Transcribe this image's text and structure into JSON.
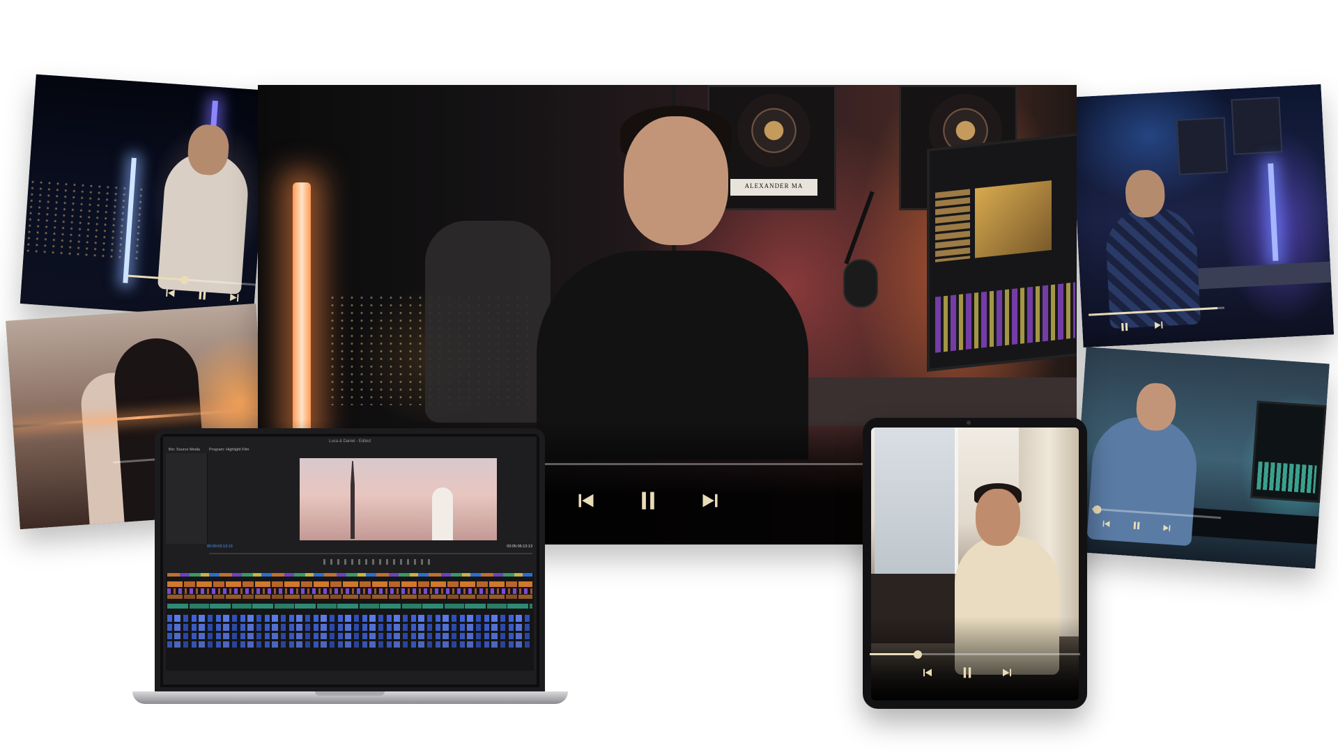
{
  "hero": {
    "award_plate": "ALEXANDER MA",
    "progress": 0.04
  },
  "card_top_left": {
    "progress": 0.45
  },
  "card_mid_left": {
    "progress": 0.0
  },
  "card_top_right": {
    "progress": 0.95
  },
  "card_bottom_right": {
    "progress": 0.04
  },
  "tablet": {
    "progress": 0.23
  },
  "laptop": {
    "app_title": "Luca & Daniel - Edited",
    "bin_tab": "Bin: Source Media",
    "program_tab": "Program: Highlight Film",
    "timecode_left": "00:00:03:13:13",
    "timecode_right": "00:05:06:13:13",
    "zoom": "Fit"
  },
  "controls": {
    "previous_icon": "skip-back-icon",
    "pause_icon": "pause-icon",
    "next_icon": "skip-forward-icon"
  },
  "colors": {
    "accent": "#e9dcb8",
    "background": "#ffffff"
  }
}
